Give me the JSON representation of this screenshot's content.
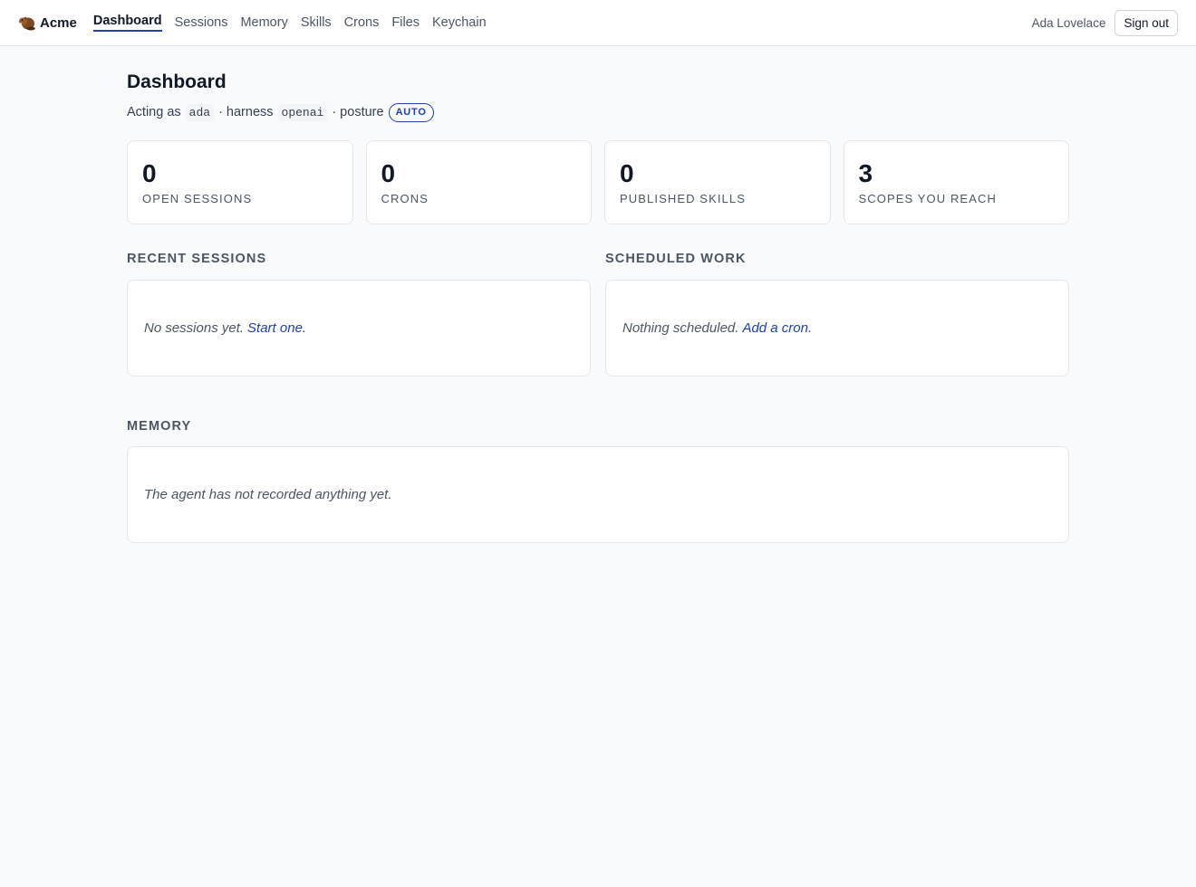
{
  "brand": {
    "name": "Acme",
    "logo_icon": "beaver-icon"
  },
  "nav": {
    "items": [
      {
        "label": "Dashboard",
        "active": true
      },
      {
        "label": "Sessions",
        "active": false
      },
      {
        "label": "Memory",
        "active": false
      },
      {
        "label": "Skills",
        "active": false
      },
      {
        "label": "Crons",
        "active": false
      },
      {
        "label": "Files",
        "active": false
      },
      {
        "label": "Keychain",
        "active": false
      }
    ]
  },
  "user": {
    "name": "Ada Lovelace",
    "sign_out_label": "Sign out"
  },
  "page": {
    "title": "Dashboard",
    "acting_as_label": "Acting as",
    "acting_as_value": "ada",
    "harness_label": "· harness",
    "harness_value": "openai",
    "posture_label": "· posture",
    "posture_value": "AUTO"
  },
  "stats": [
    {
      "value": "0",
      "label": "OPEN SESSIONS"
    },
    {
      "value": "0",
      "label": "CRONS"
    },
    {
      "value": "0",
      "label": "PUBLISHED SKILLS"
    },
    {
      "value": "3",
      "label": "SCOPES YOU REACH"
    }
  ],
  "recent_sessions": {
    "title": "RECENT SESSIONS",
    "empty_text": "No sessions yet.",
    "link_text": "Start one."
  },
  "scheduled_work": {
    "title": "SCHEDULED WORK",
    "empty_text": "Nothing scheduled.",
    "link_text": "Add a cron."
  },
  "memory": {
    "title": "MEMORY",
    "empty_text": "The agent has not recorded anything yet."
  },
  "colors": {
    "accent": "#1e40af",
    "background": "#f9fafb",
    "border": "#e5e7eb"
  }
}
